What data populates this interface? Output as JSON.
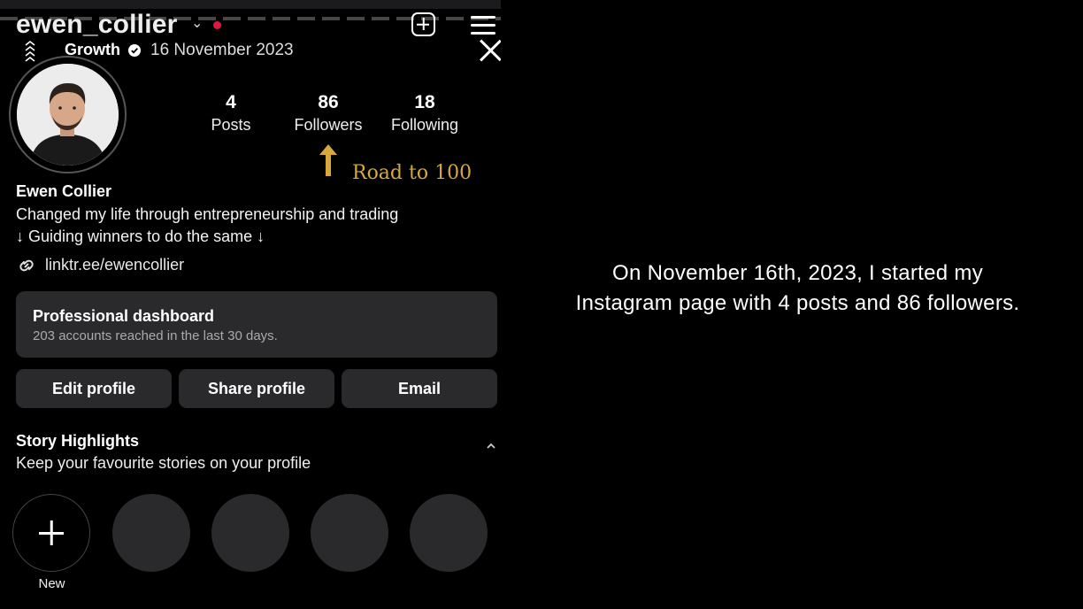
{
  "header": {
    "username": "ewen_collier",
    "username_chevron": "⌄",
    "create_icon": "plus-square-icon",
    "menu_icon": "hamburger-menu-icon",
    "close_icon": "close-icon",
    "notification_color": "#e2173f"
  },
  "highlight_preview": {
    "label": "Growth",
    "date": "16 November 2023",
    "verified_icon": "verified-badge-icon",
    "expand_icon": "triple-chevron-up-icon"
  },
  "profile": {
    "name": "Ewen Collier",
    "bio_line1": "Changed my life through entrepreneurship and trading",
    "bio_line2": "↓ Guiding winners to do the same ↓",
    "link": "linktr.ee/ewencollier",
    "link_icon": "link-icon"
  },
  "stats": [
    {
      "value": "4",
      "label": "Posts"
    },
    {
      "value": "86",
      "label": "Followers"
    },
    {
      "value": "18",
      "label": "Following"
    }
  ],
  "annotation": {
    "text": "Road to 100",
    "color": "#d8a93a",
    "arrow_icon": "gold-arrow-up-icon"
  },
  "dashboard": {
    "title": "Professional dashboard",
    "subtitle": "203 accounts reached in the last 30 days."
  },
  "buttons": {
    "edit": "Edit profile",
    "share": "Share profile",
    "email": "Email"
  },
  "story_highlights": {
    "title": "Story Highlights",
    "subtitle": "Keep your favourite stories on your profile",
    "new_label": "New",
    "collapse_icon": "chevron-up-icon"
  },
  "caption": "On November 16th, 2023, I started my Instagram page with 4 posts and 86 followers."
}
